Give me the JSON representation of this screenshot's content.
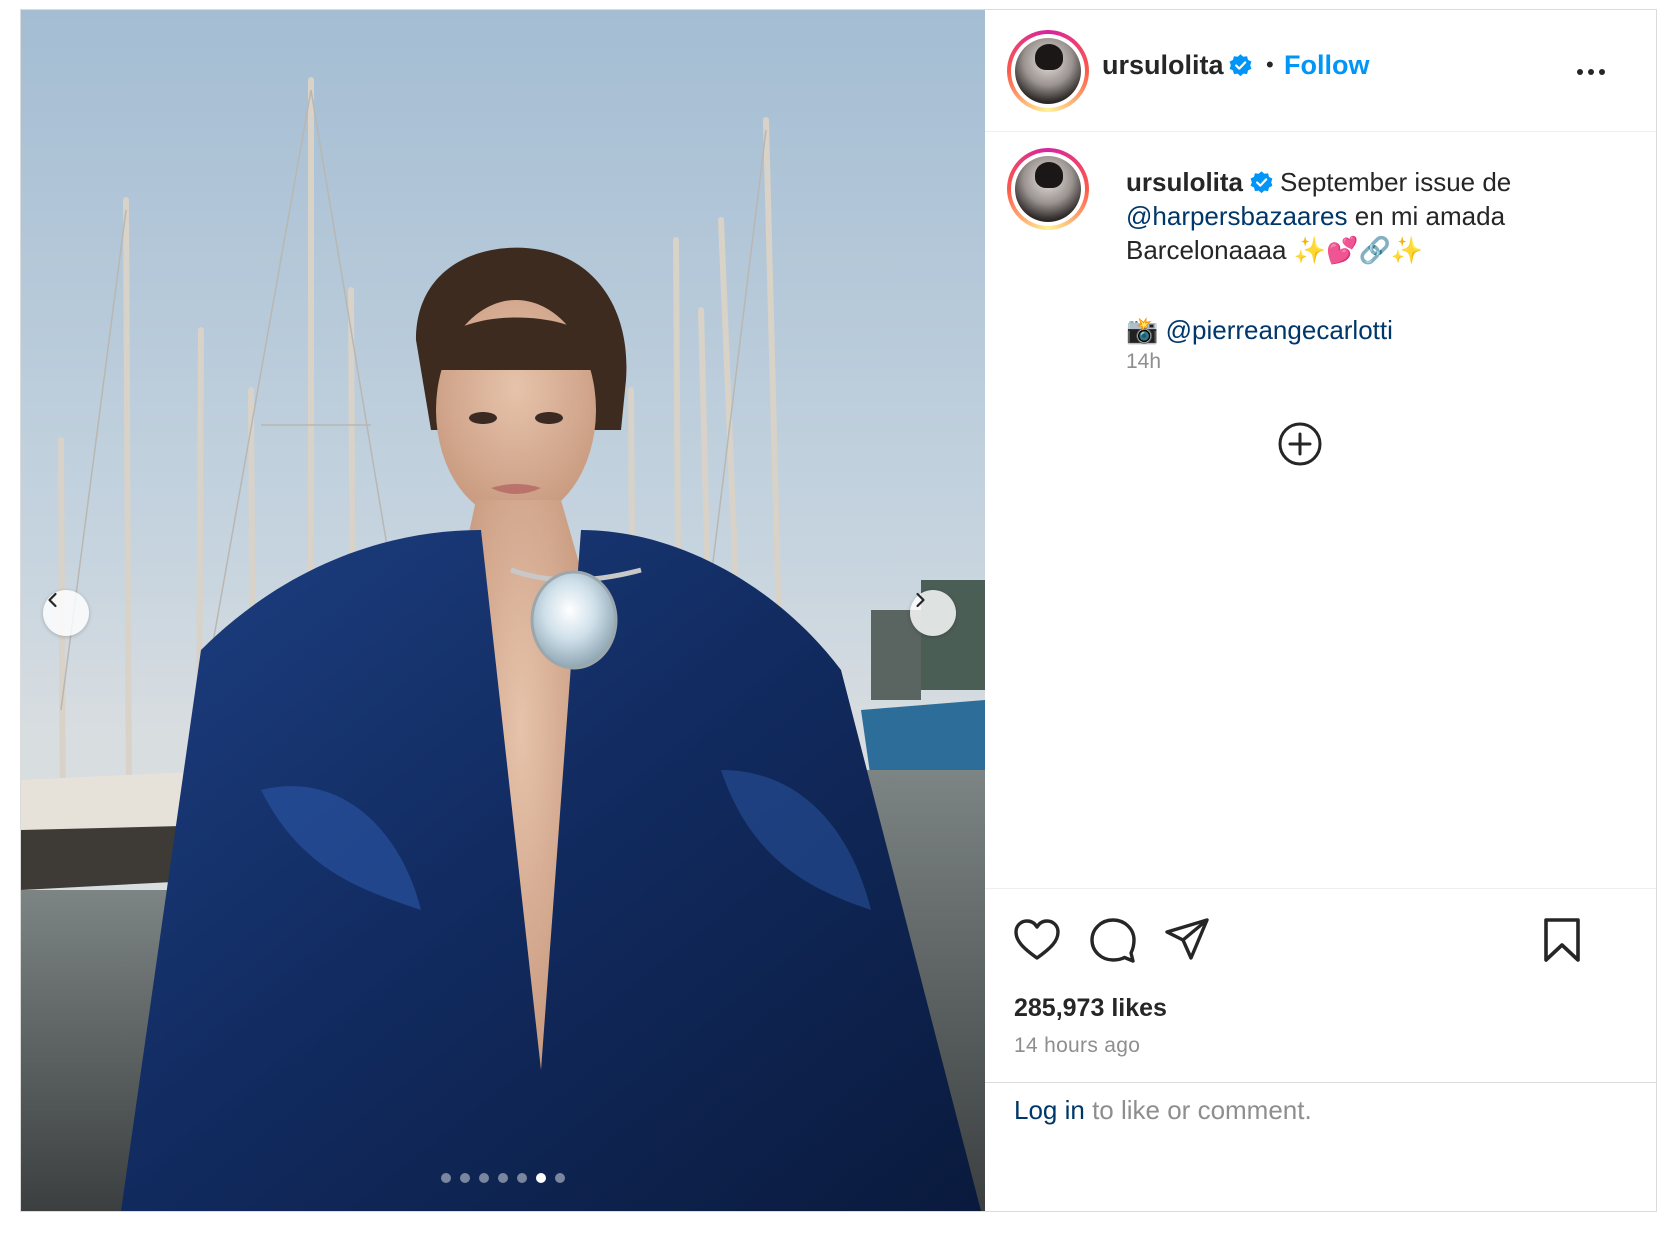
{
  "post": {
    "username": "ursulolita",
    "separator": "•",
    "follow_label": "Follow",
    "more_icon": "more-options-icon",
    "verified_icon": "verified-badge-icon",
    "carousel": {
      "total_slides": 7,
      "active_slide": 6,
      "prev_icon": "chevron-left-icon",
      "next_icon": "chevron-right-icon"
    }
  },
  "caption": {
    "username": "ursulolita",
    "text_1": "September issue de",
    "mention_1": "@harpersbazaares",
    "text_2": "en mi amada",
    "text_3": "Barcelonaaaa",
    "emojis": "✨💕🔗✨",
    "camera_emoji": "📸",
    "mention_2": "@pierreangecarlotti",
    "time": "14h",
    "add_icon": "add-circle-icon"
  },
  "actions": {
    "like_icon": "heart-icon",
    "comment_icon": "comment-icon",
    "share_icon": "share-icon",
    "save_icon": "bookmark-icon",
    "likes": "285,973 likes",
    "posted": "14 hours ago"
  },
  "login": {
    "link": "Log in",
    "rest": "to like or comment."
  },
  "colors": {
    "accent": "#0095f6",
    "link": "#00376b",
    "muted": "#8e8e8e",
    "text": "#262626",
    "border": "#dbdbdb"
  }
}
